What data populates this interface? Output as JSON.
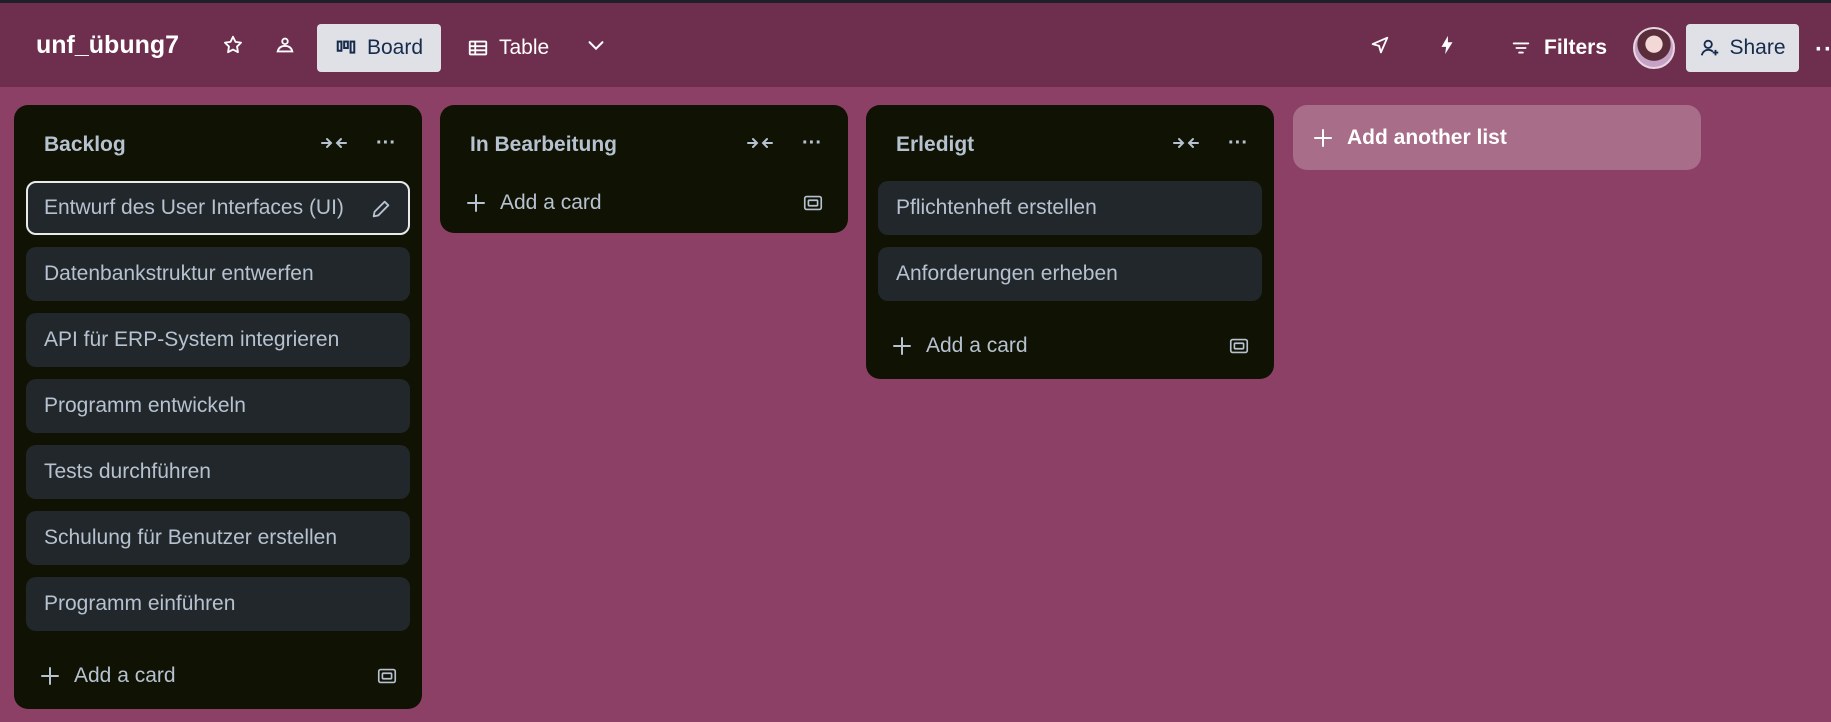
{
  "header": {
    "board_title": "unf_übung7",
    "views": {
      "board": "Board",
      "table": "Table"
    },
    "filters_label": "Filters",
    "share_label": "Share"
  },
  "lists": [
    {
      "title": "Backlog",
      "cards": [
        "Entwurf des User Interfaces (UI)",
        "Datenbankstruktur entwerfen",
        "API für ERP-System integrieren",
        "Programm entwickeln",
        "Tests durchführen",
        "Schulung für Benutzer erstellen",
        "Programm einführen"
      ],
      "add_card_label": "Add a card"
    },
    {
      "title": "In Bearbeitung",
      "cards": [],
      "add_card_label": "Add a card"
    },
    {
      "title": "Erledigt",
      "cards": [
        "Pflichtenheft erstellen",
        "Anforderungen erheben"
      ],
      "add_card_label": "Add a card"
    }
  ],
  "add_list_label": "Add another list",
  "colors": {
    "board_background": "#8d4065",
    "header_background": "#6e2f4f",
    "list_background": "#101204",
    "card_background": "#22272b",
    "text_muted": "#b6c2cf"
  }
}
